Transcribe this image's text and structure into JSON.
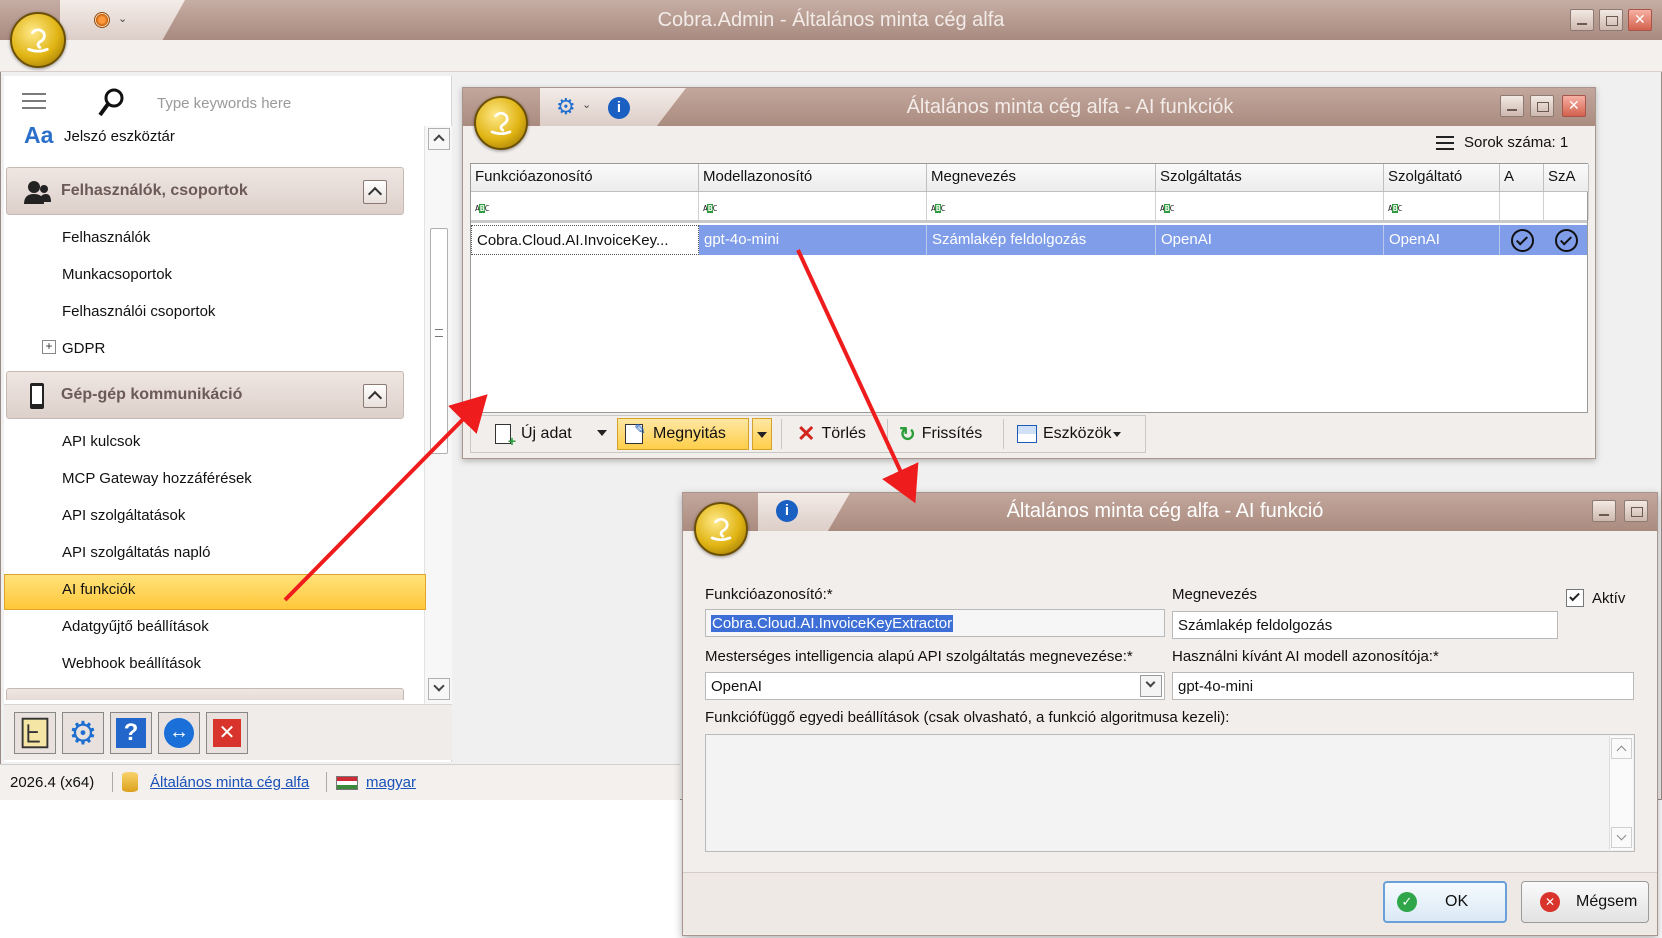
{
  "main_window": {
    "title": "Cobra.Admin - Általános minta cég alfa"
  },
  "sidebar": {
    "search_placeholder": "Type keywords here",
    "password_toolbar": "Jelszó eszköztár",
    "aa_glyph": "Aa",
    "groups": [
      {
        "title": "Felhasználók, csoportok",
        "items": [
          "Felhasználók",
          "Munkacsoportok",
          "Felhasználói csoportok",
          "GDPR"
        ]
      },
      {
        "title": "Gép-gép kommunikáció",
        "items": [
          "API kulcsok",
          "MCP Gateway hozzáférések",
          "API szolgáltatások",
          "API szolgáltatás napló",
          "AI funkciók",
          "Adatgyűjtő beállítások",
          "Webhook beállítások"
        ]
      }
    ],
    "selected_item": "AI funkciók"
  },
  "statusbar": {
    "version": "2026.4 (x64)",
    "company": "Általános minta cég alfa",
    "language": "magyar"
  },
  "list_window": {
    "title": "Általános minta cég alfa - AI funkciók",
    "row_count_label": "Sorok száma: 1",
    "columns": [
      "Funkcióazonosító",
      "Modellazonosító",
      "Megnevezés",
      "Szolgáltatás",
      "Szolgáltató",
      "A",
      "SzA"
    ],
    "rows": [
      {
        "id": "Cobra.Cloud.AI.InvoiceKey...",
        "model": "gpt-4o-mini",
        "name": "Számlakép feldolgozás",
        "service": "OpenAI",
        "provider": "OpenAI",
        "a": true,
        "sza": true
      }
    ],
    "toolbar": {
      "new": "Új adat",
      "open": "Megnyitás",
      "delete": "Törlés",
      "refresh": "Frissítés",
      "tools": "Eszközök"
    }
  },
  "detail_window": {
    "title": "Általános minta cég alfa - AI funkció",
    "function_id_label": "Funkcióazonosító:*",
    "function_id_value": "Cobra.Cloud.AI.InvoiceKeyExtractor",
    "name_label": "Megnevezés",
    "name_value": "Számlakép feldolgozás",
    "active_label": "Aktív",
    "active_checked": true,
    "service_label": "Mesterséges intelligencia alapú API szolgáltatás megnevezése:*",
    "service_value": "OpenAI",
    "model_label": "Használni kívánt AI modell azonosítója:*",
    "model_value": "gpt-4o-mini",
    "settings_label": "Funkciófüggő egyedi beállítások (csak olvasható, a funkció algoritmusa kezeli):",
    "ok": "OK",
    "cancel": "Mégsem"
  },
  "colors": {
    "title_bar": "#b49488",
    "selection": "#7f9de8",
    "highlight_row": "#ffd24a",
    "arrow": "#ee1c1c"
  }
}
